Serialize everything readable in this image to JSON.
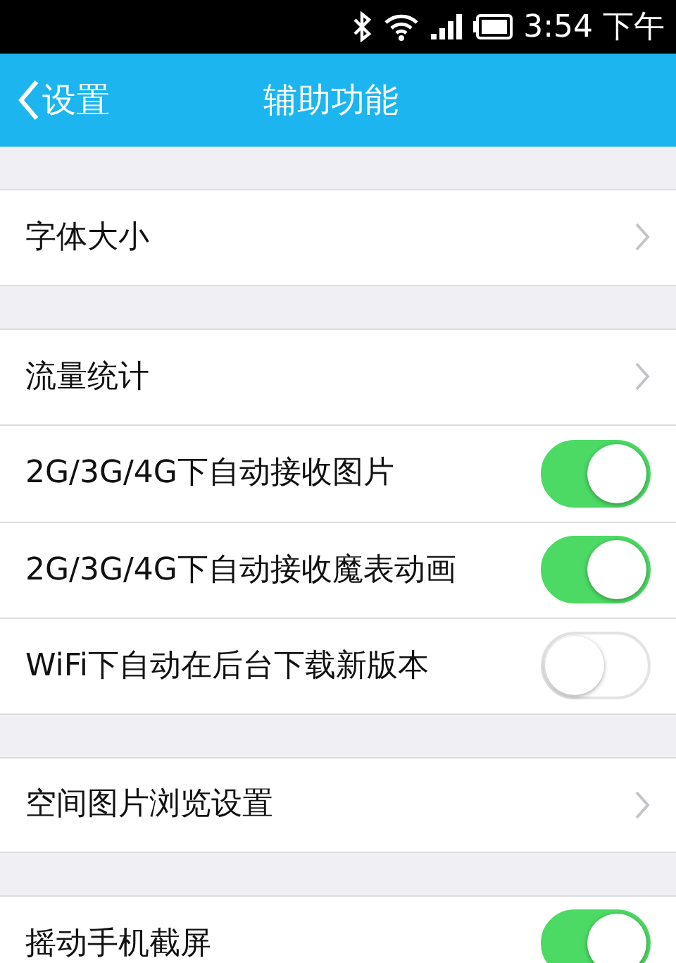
{
  "status_bar": {
    "time": "3:54 下午"
  },
  "header": {
    "back_label": "设置",
    "title": "辅助功能"
  },
  "sections": [
    {
      "rows": [
        {
          "kind": "link",
          "label": "字体大小"
        }
      ]
    },
    {
      "rows": [
        {
          "kind": "link",
          "label": "流量统计"
        },
        {
          "kind": "switch",
          "label": "2G/3G/4G下自动接收图片",
          "on": true
        },
        {
          "kind": "switch",
          "label": "2G/3G/4G下自动接收魔表动画",
          "on": true
        },
        {
          "kind": "switch",
          "label": "WiFi下自动在后台下载新版本",
          "on": false
        }
      ]
    },
    {
      "rows": [
        {
          "kind": "link",
          "label": "空间图片浏览设置"
        }
      ]
    },
    {
      "rows": [
        {
          "kind": "switch",
          "label": "摇动手机截屏",
          "on": true
        }
      ]
    }
  ]
}
